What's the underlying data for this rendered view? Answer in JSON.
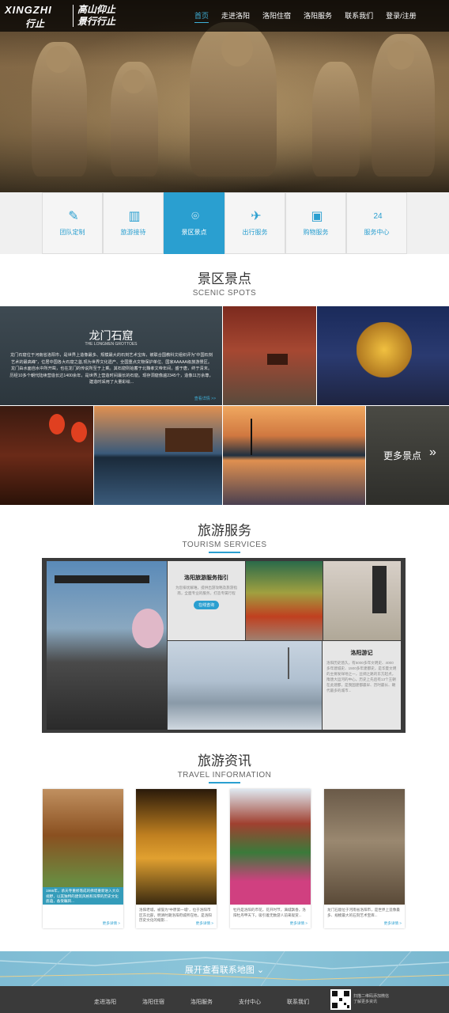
{
  "header": {
    "logo_en": "XINGZHI",
    "logo_cn1": "行止",
    "logo_cn2_line1": "高山仰止",
    "logo_cn2_line2": "景行行止",
    "nav": [
      "首页",
      "走进洛阳",
      "洛阳住宿",
      "洛阳服务",
      "联系我们",
      "登录/注册"
    ]
  },
  "services": [
    {
      "label": "团队定制",
      "icon": "edit-icon"
    },
    {
      "label": "旅游接待",
      "icon": "building-icon"
    },
    {
      "label": "景区景点",
      "icon": "location-icon"
    },
    {
      "label": "出行服务",
      "icon": "plane-icon"
    },
    {
      "label": "购物服务",
      "icon": "bag-icon"
    },
    {
      "label": "服务中心",
      "icon": "24h-icon"
    }
  ],
  "scenic": {
    "title_cn": "景区景点",
    "title_en": "SCENIC SPOTS",
    "feature_title": "龙门石窟",
    "feature_subtitle": "THE LONGMEN GROTTOES",
    "feature_desc": "龙门石窟位于河南省洛阳市，是世界上造像最多、规模最大的石刻艺术宝库，被联合国教科文组织评为\"中国石刻艺术的最高峰\"，位居中国各大石窟之首,现为世界文化遗产、全国重点文物保护单位、国家AAAAA级旅游景区。龙门由水面自水中所开凿，也在龙门的传说所至于上乘。其石窟则始蓄于北魏孝文帝年间，盛于唐，终于清末。历经10多个朝代陆续营造长达1400余年，是世界上营造时间最长的石窟。现存洞窟像遍2345个，造像11万余尊，建造时采用了大量彩绘...",
    "feature_more": "查看详情 >>",
    "more_label": "更多景点"
  },
  "tourism": {
    "title_cn": "旅游服务",
    "title_en": "TOURISM SERVICES",
    "card1_title": "洛阳旅游服务指引",
    "card1_desc": "为您排忧解难，提供出游攻略及旅游指南，全面专业的服务，打造专属行程",
    "card1_button": "在线咨询",
    "card2_title": "洛阳游记",
    "card2_desc": "洛阳历史悠久，有5000多年文明史、4000多年建城史、1500多年建都史，是华夏文明的主要发祥地之一，丝绸之路的东方起点，隋唐大运河的中心。历史上先后有13个王朝在此建都，是我国建都最早、历时最长、朝代最多的城市..."
  },
  "info": {
    "title_cn": "旅游资讯",
    "title_en": "TRAVEL INFORMATION",
    "cards": [
      {
        "caption": "1966年，承天寺重修落成的佛塔重新进入大众视野，以其独特的建筑风格和深厚的历史文化底蕴，备受瞩目...",
        "more": "更多详情 >"
      },
      {
        "caption": "洛阳老城，被誉为\"中原第一城\"，位于洛阳市区东北部，明清时期洛阳府城所在地，是洛阳历史文化的缩影...",
        "more": "更多详情 >"
      },
      {
        "caption": "牡丹是洛阳的市花，花开时节，满城飘香，洛阳牡丹甲天下，吸引着无数游人前来观赏...",
        "more": "更多详情 >"
      },
      {
        "caption": "龙门石窟位于河南省洛阳市，是世界上造像最多、规模最大的石刻艺术宝库...",
        "more": "更多详情 >"
      }
    ]
  },
  "map": {
    "label": "展开查看联系地图"
  },
  "footer": {
    "links": [
      "走进洛阳",
      "洛阳住宿",
      "洛阳服务",
      "支付中心",
      "联系我们"
    ],
    "qr_text_1": "扫描二维码添加微信",
    "qr_text_2": "了解更多资讯"
  }
}
